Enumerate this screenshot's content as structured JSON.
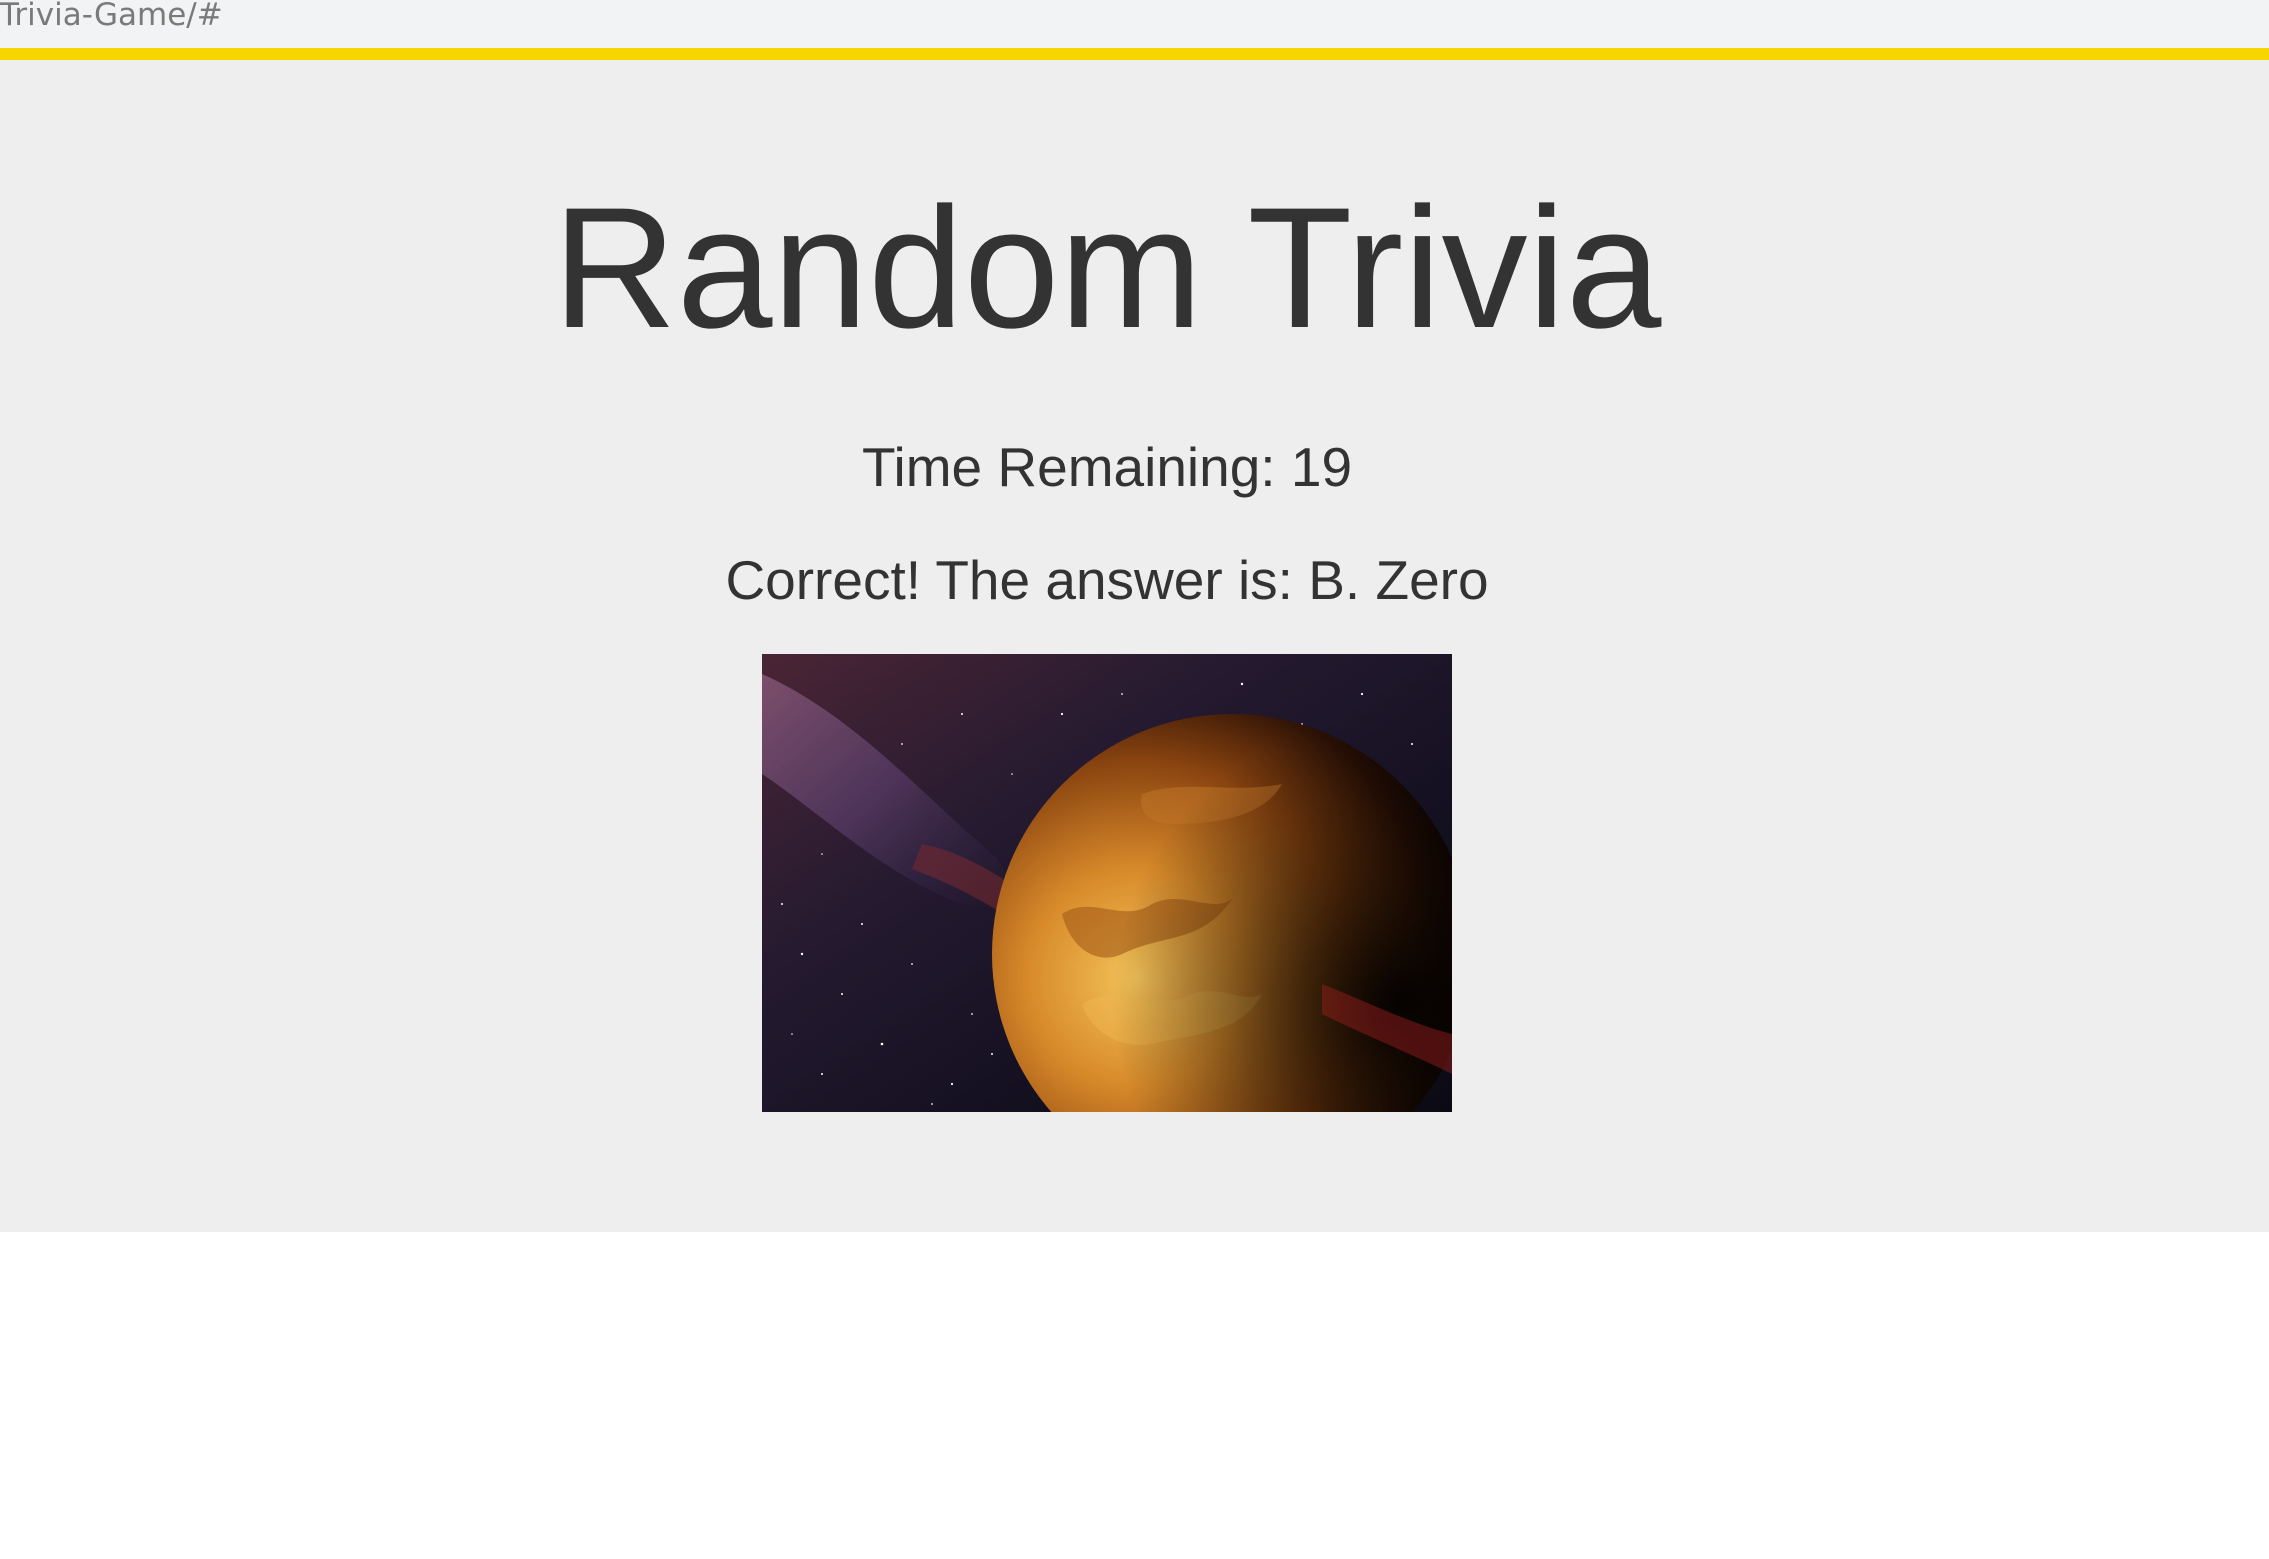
{
  "browser": {
    "address": "Trivia-Game/#"
  },
  "page": {
    "title": "Random Trivia",
    "timer_label": "Time Remaining: ",
    "timer_value": "19",
    "result_message": "Correct! The answer is: B. Zero"
  },
  "image": {
    "subject": "planet-in-space",
    "alt": ""
  },
  "colors": {
    "accent": "#f7d600",
    "background": "#eeeeee",
    "text": "#333333"
  }
}
